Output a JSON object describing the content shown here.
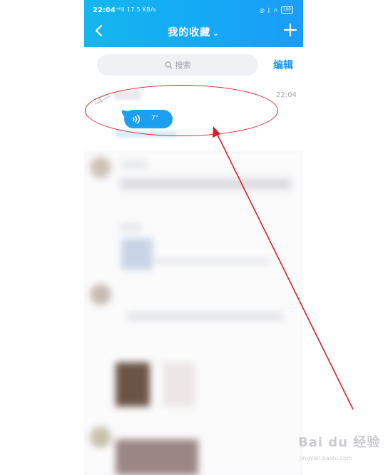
{
  "status_bar": {
    "time": "22:04",
    "signal": "⁴⁶ll 17.5 KB/s",
    "battery": "100"
  },
  "header": {
    "title": "我的收藏",
    "title_chevron": "⌄",
    "back_icon": "chevron-left-icon",
    "add_icon": "plus-icon"
  },
  "search": {
    "placeholder": "搜索",
    "edit_label": "编辑"
  },
  "favorites": [
    {
      "time": "22:04",
      "voice_duration": "7\""
    }
  ],
  "watermark": {
    "text": "Bai du 经验",
    "url": "jingyan.baidu.com"
  },
  "colors": {
    "header_start": "#14b6ef",
    "header_end": "#1b9cf8",
    "accent": "#1698ee",
    "annotation": "#d71f26"
  }
}
